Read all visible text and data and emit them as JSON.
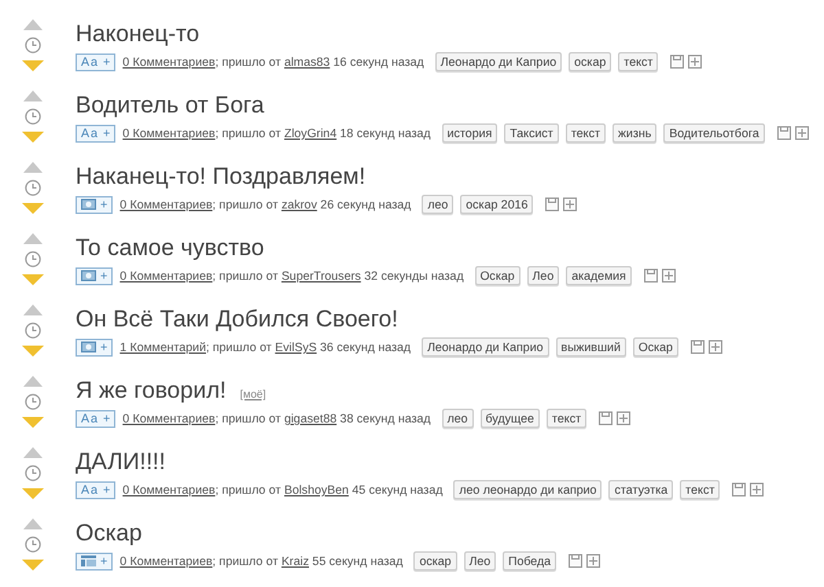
{
  "posts": [
    {
      "title": "Наконец-то",
      "badge": {
        "kind": "text",
        "label": "Aa",
        "plus": "+"
      },
      "comments": "0 Комментариев",
      "from": "; пришло от",
      "author": "almas83",
      "time": "16 секунд назад",
      "tags": [
        "Леонардо ди Каприо",
        "оскар",
        "текст"
      ]
    },
    {
      "title": "Водитель от Бога",
      "badge": {
        "kind": "text",
        "label": "Aa",
        "plus": "+"
      },
      "comments": "0 Комментариев",
      "from": "; пришло от",
      "author": "ZloyGrin4",
      "time": "18 секунд назад",
      "tags": [
        "история",
        "Таксист",
        "текст",
        "жизнь",
        "Водительотбога"
      ]
    },
    {
      "title": "Наканец-то! Поздравляем!",
      "badge": {
        "kind": "image",
        "plus": "+"
      },
      "comments": "0 Комментариев",
      "from": "; пришло от",
      "author": "zakrov",
      "time": "26 секунд назад",
      "tags": [
        "лео",
        "оскар 2016"
      ]
    },
    {
      "title": "То самое чувство",
      "badge": {
        "kind": "image",
        "plus": "+"
      },
      "comments": "0 Комментариев",
      "from": "; пришло от",
      "author": "SuperTrousers",
      "time": "32 секунды назад",
      "tags": [
        "Оскар",
        "Лео",
        "академия"
      ]
    },
    {
      "title": "Он Всё Таки Добился Своего!",
      "badge": {
        "kind": "image",
        "plus": "+"
      },
      "comments": "1 Комментарий",
      "from": "; пришло от",
      "author": "EvilSyS",
      "time": "36 секунд назад",
      "tags": [
        "Леонардо ди Каприо",
        "выживший",
        "Оскар"
      ]
    },
    {
      "title": "Я же говорил!",
      "mine": "[моё]",
      "badge": {
        "kind": "text",
        "label": "Aa",
        "plus": "+"
      },
      "comments": "0 Комментариев",
      "from": "; пришло от",
      "author": "gigaset88",
      "time": "38 секунд назад",
      "tags": [
        "лео",
        "будущее",
        "текст"
      ]
    },
    {
      "title": "ДАЛИ!!!!",
      "badge": {
        "kind": "text",
        "label": "Aa",
        "plus": "+"
      },
      "comments": "0 Комментариев",
      "from": "; пришло от",
      "author": "BolshoyBen",
      "time": "45 секунд назад",
      "tags": [
        "лео леонардо ди каприо",
        "статуэтка",
        "текст"
      ]
    },
    {
      "title": "Оскар",
      "badge": {
        "kind": "layout",
        "plus": "+"
      },
      "comments": "0 Комментариев",
      "from": "; пришло от",
      "author": "Kraiz",
      "time": "55 секунд назад",
      "tags": [
        "оскар",
        "Лео",
        "Победа"
      ]
    }
  ]
}
